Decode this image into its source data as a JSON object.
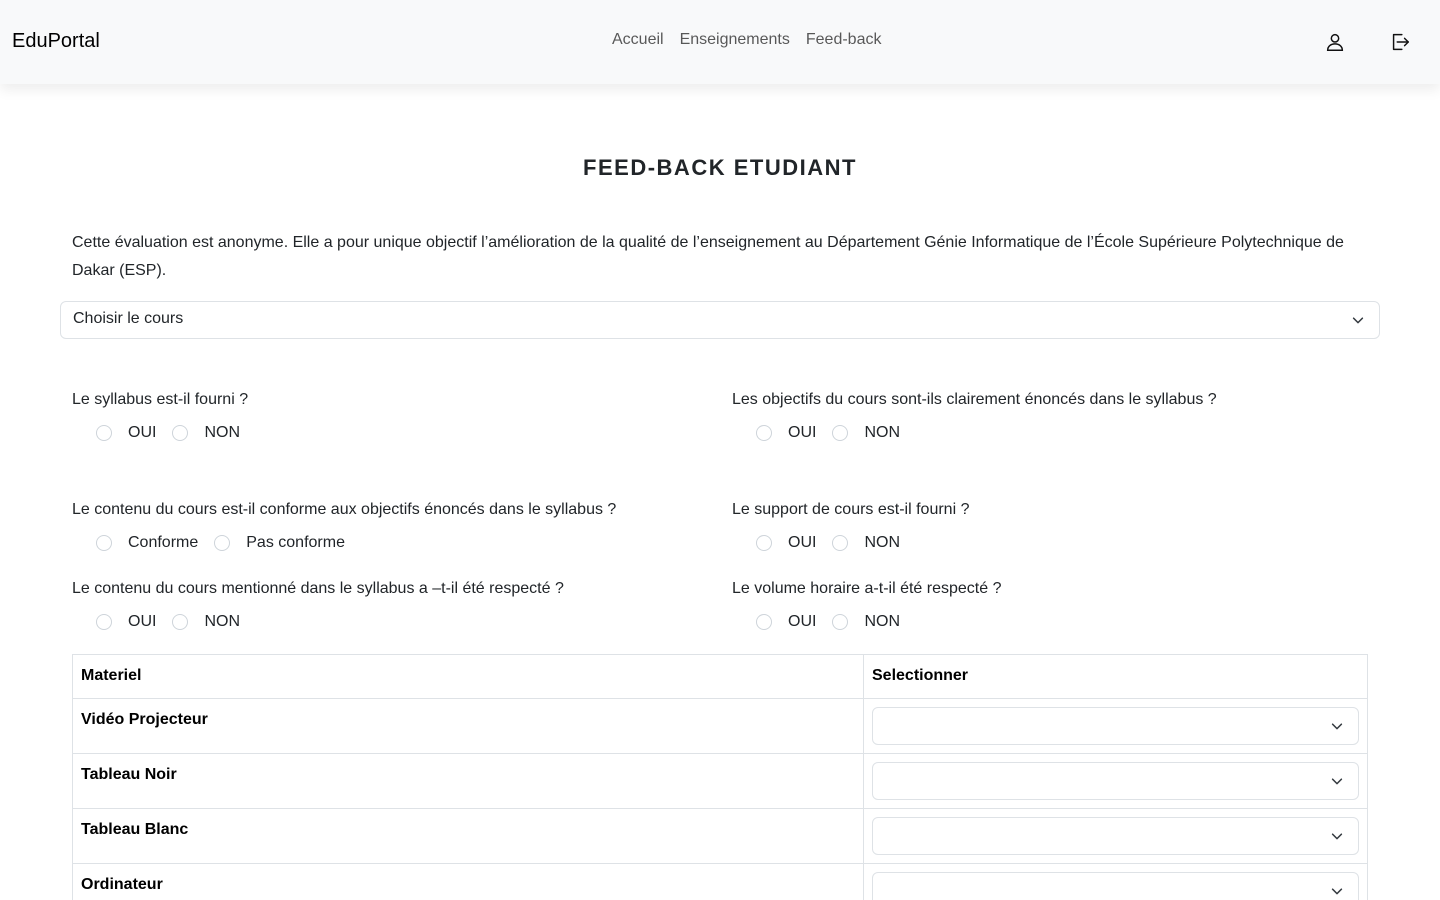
{
  "navbar": {
    "brand": "EduPortal",
    "links": [
      "Accueil",
      "Enseignements",
      "Feed-back"
    ],
    "icons": [
      "user-icon",
      "logout-icon"
    ]
  },
  "page": {
    "title": "FEED-BACK ETUDIANT",
    "intro": "Cette évaluation est anonyme. Elle a pour unique objectif l’amélioration de la qualité de l’enseignement au Département Génie Informatique de l’École Supérieure Polytechnique de Dakar (ESP)."
  },
  "course_select": {
    "value": "Choisir le cours"
  },
  "questions": [
    {
      "label": "Le syllabus est-il fourni ?",
      "options": [
        "OUI",
        "NON"
      ]
    },
    {
      "label": "Les objectifs du cours sont-ils clairement énoncés dans le syllabus ?",
      "options": [
        "OUI",
        "NON"
      ]
    },
    {
      "label": "Le contenu du cours est-il conforme aux objectifs énoncés dans le syllabus ?",
      "options": [
        "Conforme",
        "Pas conforme"
      ]
    },
    {
      "label": "Le support de cours est-il fourni ?",
      "options": [
        "OUI",
        "NON"
      ]
    },
    {
      "label": "Le contenu du cours mentionné dans le syllabus a –t-il été respecté ?",
      "options": [
        "OUI",
        "NON"
      ]
    },
    {
      "label": "Le volume horaire a-t-il été respecté ?",
      "options": [
        "OUI",
        "NON"
      ]
    }
  ],
  "materials": {
    "headers": [
      "Materiel",
      "Selectionner"
    ],
    "rows": [
      {
        "name": "Vidéo Projecteur",
        "value": ""
      },
      {
        "name": "Tableau Noir",
        "value": ""
      },
      {
        "name": "Tableau Blanc",
        "value": ""
      },
      {
        "name": "Ordinateur",
        "value": ""
      }
    ]
  }
}
